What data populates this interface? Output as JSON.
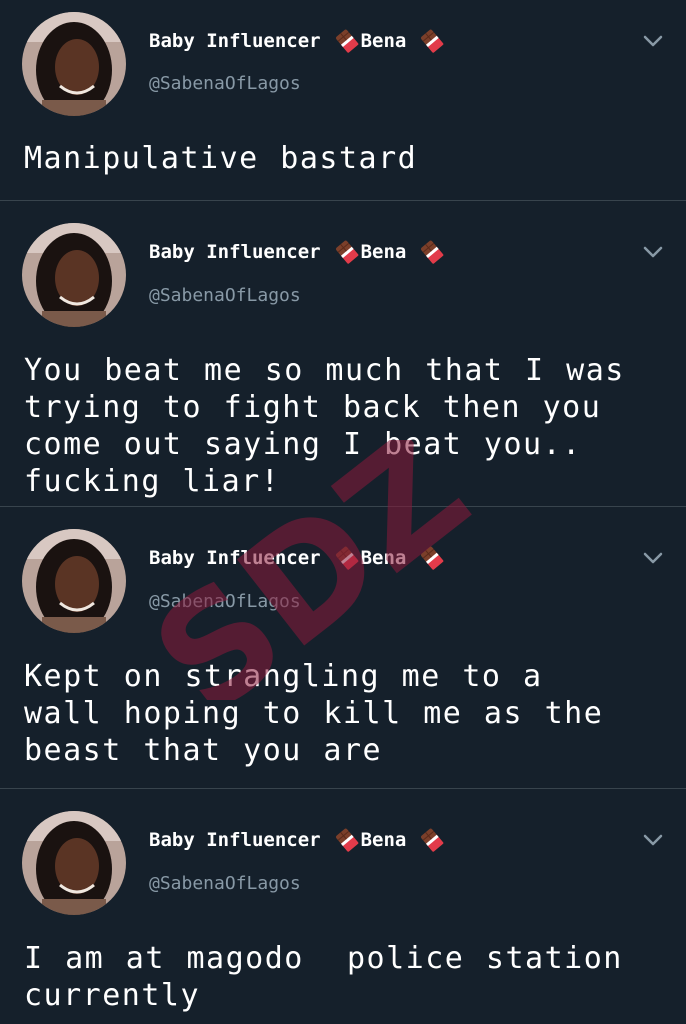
{
  "tweets": [
    {
      "author": {
        "name_prefix": "Baby Influencer",
        "name_suffix": "Bena",
        "handle": "@SabenaOfLagos"
      },
      "text": "Manipulative bastard",
      "menu_icon": "chevron-down-icon",
      "emoji_icon": "chocolate-bar-icon"
    },
    {
      "author": {
        "name_prefix": "Baby Influencer",
        "name_suffix": "Bena",
        "handle": "@SabenaOfLagos"
      },
      "text": "You beat me so much that I was\ntrying to fight back then you\ncome out saying I beat you..\nfucking liar!",
      "menu_icon": "chevron-down-icon",
      "emoji_icon": "chocolate-bar-icon"
    },
    {
      "author": {
        "name_prefix": "Baby Influencer",
        "name_suffix": "Bena",
        "handle": "@SabenaOfLagos"
      },
      "text": "Kept on strangling me to a\nwall hoping to kill me as the\nbeast that you are",
      "menu_icon": "chevron-down-icon",
      "emoji_icon": "chocolate-bar-icon"
    },
    {
      "author": {
        "name_prefix": "Baby Influencer",
        "name_suffix": "Bena",
        "handle": "@SabenaOfLagos"
      },
      "text": "I am at magodo  police station\ncurrently",
      "menu_icon": "chevron-down-icon",
      "emoji_icon": "chocolate-bar-icon"
    }
  ],
  "watermark": {
    "text": "SDZ",
    "color": "#8b1a3a"
  },
  "colors": {
    "background": "#15202b",
    "divider": "#38444d",
    "secondary_text": "#8899a6"
  }
}
